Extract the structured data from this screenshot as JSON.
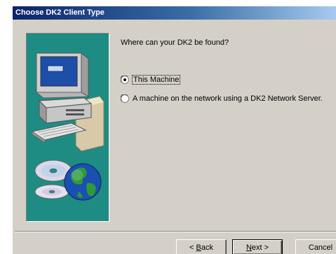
{
  "window": {
    "title": "Choose DK2 Client Type"
  },
  "prompt": {
    "question": "Where can your DK2 be found?"
  },
  "options": [
    {
      "label": "This Machine",
      "selected": true
    },
    {
      "label": "A machine on the network using a DK2 Network Server.",
      "selected": false
    }
  ],
  "buttons": {
    "back_accel": "B",
    "back_rest": "ack",
    "back_prefix": "< ",
    "next_accel": "N",
    "next_rest": "ext",
    "next_suffix": " >",
    "cancel": "Cancel"
  },
  "colors": {
    "dialog_face": "#d4d0c8",
    "title_start": "#0a246a",
    "title_end": "#a6caf0",
    "art_background": "#1e8c82"
  },
  "icons": {
    "art": [
      "computer-icon",
      "cd-disc-icon",
      "globe-icon"
    ]
  }
}
